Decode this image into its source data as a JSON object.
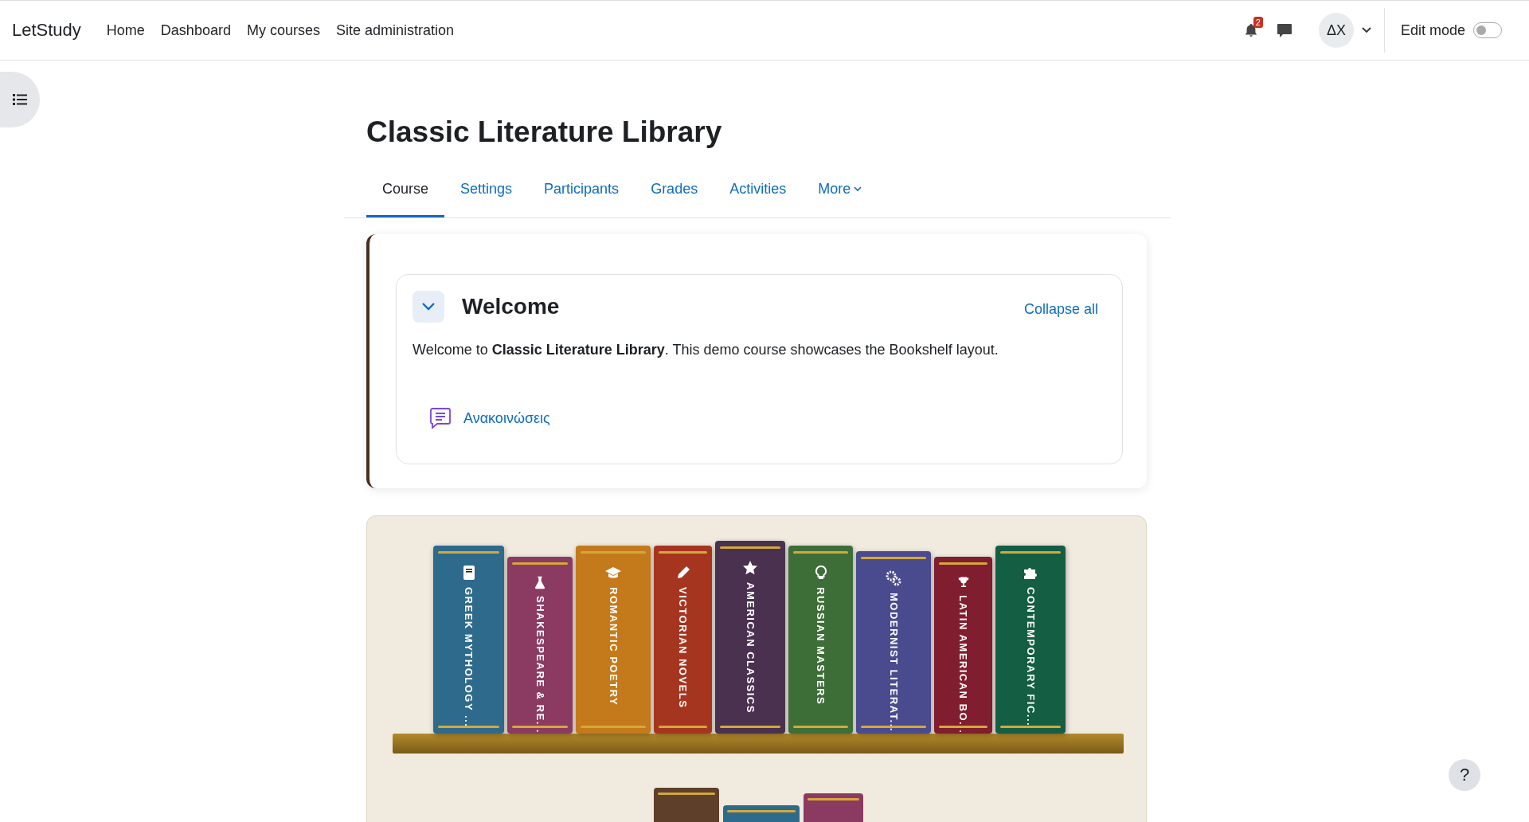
{
  "navbar": {
    "brand": "LetStudy",
    "links": [
      "Home",
      "Dashboard",
      "My courses",
      "Site administration"
    ],
    "notifications_count": "2",
    "avatar_initials": "ΔX",
    "edit_mode": {
      "label": "Edit mode",
      "on": false
    }
  },
  "course": {
    "title": "Classic Literature Library",
    "tabs": [
      {
        "label": "Course",
        "selected": true,
        "kind": "link"
      },
      {
        "label": "Settings",
        "selected": false,
        "kind": "link"
      },
      {
        "label": "Participants",
        "selected": false,
        "kind": "link"
      },
      {
        "label": "Grades",
        "selected": false,
        "kind": "link"
      },
      {
        "label": "Activities",
        "selected": false,
        "kind": "link"
      },
      {
        "label": "More",
        "selected": false,
        "kind": "menu"
      }
    ]
  },
  "section": {
    "title": "Welcome",
    "expanded": true,
    "collapse_all": "Collapse all",
    "summary": "Welcome to **Classic Literature Library**. This demo course showcases the Bookshelf layout.",
    "activities": [
      {
        "name": "Ανακοινώσεις"
      }
    ]
  },
  "bookshelf": {
    "books": [
      {
        "title": "GREEK MYTHOLOGY ...",
        "color": "#2e6a8c"
      },
      {
        "title": "SHAKESPEARE & RE...",
        "color": "#8b3a62"
      },
      {
        "title": "ROMANTIC POETRY",
        "color": "#c47a1a"
      },
      {
        "title": "VICTORIAN NOVELS",
        "color": "#a63520"
      },
      {
        "title": "AMERICAN CLASSICS",
        "color": "#4a3150"
      },
      {
        "title": "RUSSIAN MASTERS",
        "color": "#3e6e38"
      },
      {
        "title": "MODERNIST LITERAT...",
        "color": "#4a4a8e"
      },
      {
        "title": "LATIN AMERICAN BO...",
        "color": "#801d2e"
      },
      {
        "title": "CONTEMPORARY FIC...",
        "color": "#145e44"
      }
    ],
    "second_row": [
      {
        "color": "#5e3f2a"
      },
      {
        "color": "#2e6a8c"
      },
      {
        "color": "#8b3a62"
      }
    ]
  },
  "help_button": "?"
}
